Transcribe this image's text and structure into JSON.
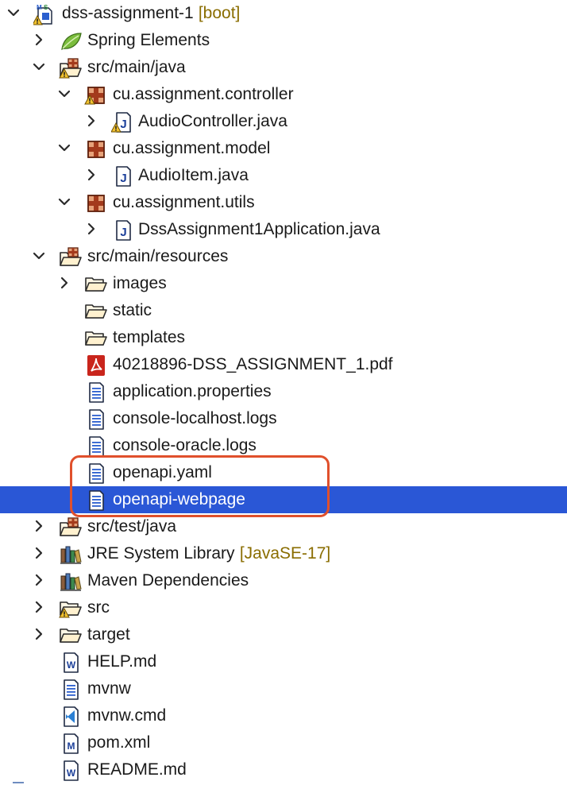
{
  "tree": {
    "rows": [
      {
        "label": "dss-assignment-1",
        "extra": " [boot]",
        "chevron": "down",
        "icon": "boot-project-icon",
        "depth": 0
      },
      {
        "label": "Spring Elements",
        "extra": "",
        "chevron": "right",
        "icon": "spring-leaf-icon",
        "depth": 1
      },
      {
        "label": "src/main/java",
        "extra": "",
        "chevron": "down",
        "icon": "source-folder-warning-icon",
        "depth": 1
      },
      {
        "label": "cu.assignment.controller",
        "extra": "",
        "chevron": "down",
        "icon": "package-warning-icon",
        "depth": 2
      },
      {
        "label": "AudioController.java",
        "extra": "",
        "chevron": "right",
        "icon": "java-file-warning-icon",
        "depth": 3
      },
      {
        "label": "cu.assignment.model",
        "extra": "",
        "chevron": "down",
        "icon": "package-icon",
        "depth": 2
      },
      {
        "label": "AudioItem.java",
        "extra": "",
        "chevron": "right",
        "icon": "java-file-icon",
        "depth": 3
      },
      {
        "label": "cu.assignment.utils",
        "extra": "",
        "chevron": "down",
        "icon": "package-icon",
        "depth": 2
      },
      {
        "label": "DssAssignment1Application.java",
        "extra": "",
        "chevron": "right",
        "icon": "java-file-icon",
        "depth": 3
      },
      {
        "label": "src/main/resources",
        "extra": "",
        "chevron": "down",
        "icon": "source-folder-icon",
        "depth": 1
      },
      {
        "label": "images",
        "extra": "",
        "chevron": "right",
        "icon": "folder-icon",
        "depth": 2
      },
      {
        "label": "static",
        "extra": "",
        "chevron": "none",
        "icon": "folder-icon",
        "depth": 2
      },
      {
        "label": "templates",
        "extra": "",
        "chevron": "none",
        "icon": "folder-icon",
        "depth": 2
      },
      {
        "label": "40218896-DSS_ASSIGNMENT_1.pdf",
        "extra": "",
        "chevron": "none",
        "icon": "pdf-file-icon",
        "depth": 2
      },
      {
        "label": "application.properties",
        "extra": "",
        "chevron": "none",
        "icon": "text-file-icon",
        "depth": 2
      },
      {
        "label": "console-localhost.logs",
        "extra": "",
        "chevron": "none",
        "icon": "text-file-icon",
        "depth": 2
      },
      {
        "label": "console-oracle.logs",
        "extra": "",
        "chevron": "none",
        "icon": "text-file-icon",
        "depth": 2
      },
      {
        "label": "openapi.yaml",
        "extra": "",
        "chevron": "none",
        "icon": "text-file-icon",
        "depth": 2
      },
      {
        "label": "openapi-webpage",
        "extra": "",
        "chevron": "none",
        "icon": "text-file-icon",
        "depth": 2,
        "selected": true
      },
      {
        "label": "src/test/java",
        "extra": "",
        "chevron": "right",
        "icon": "source-folder-icon",
        "depth": 1
      },
      {
        "label": "JRE System Library",
        "extra": " [JavaSE-17]",
        "chevron": "right",
        "icon": "library-icon",
        "depth": 1
      },
      {
        "label": "Maven Dependencies",
        "extra": "",
        "chevron": "right",
        "icon": "library-icon",
        "depth": 1
      },
      {
        "label": "src",
        "extra": "",
        "chevron": "right",
        "icon": "folder-warning-icon",
        "depth": 1
      },
      {
        "label": "target",
        "extra": "",
        "chevron": "right",
        "icon": "folder-icon",
        "depth": 1
      },
      {
        "label": "HELP.md",
        "extra": "",
        "chevron": "none",
        "icon": "word-file-icon",
        "depth": 1
      },
      {
        "label": "mvnw",
        "extra": "",
        "chevron": "none",
        "icon": "text-file-icon",
        "depth": 1
      },
      {
        "label": "mvnw.cmd",
        "extra": "",
        "chevron": "none",
        "icon": "vscode-file-icon",
        "depth": 1
      },
      {
        "label": "pom.xml",
        "extra": "",
        "chevron": "none",
        "icon": "maven-pom-icon",
        "depth": 1
      },
      {
        "label": "README.md",
        "extra": "",
        "chevron": "none",
        "icon": "word-file-icon",
        "depth": 1
      }
    ]
  },
  "colors": {
    "selection": "#2a57d6",
    "highlight_border": "#e0502c",
    "decoration_text": "#8a6d00"
  }
}
